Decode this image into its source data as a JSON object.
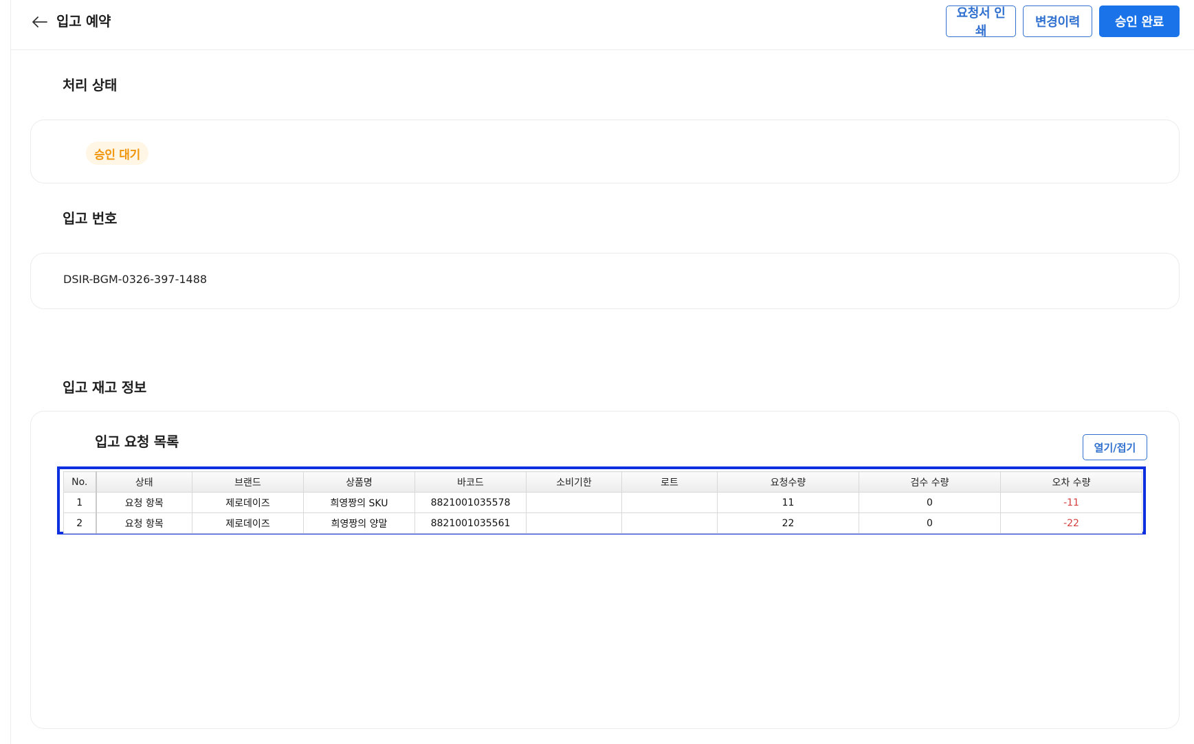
{
  "header": {
    "title": "입고 예약",
    "buttons": {
      "print": "요청서 인쇄",
      "history": "변경이력",
      "approve": "승인 완료"
    }
  },
  "status_section": {
    "label": "처리 상태",
    "badge": "승인 대기"
  },
  "number_section": {
    "label": "입고 번호",
    "value": "DSIR-BGM-0326-397-1488"
  },
  "inventory_section": {
    "label": "입고 재고 정보",
    "list_title": "입고 요청 목록",
    "toggle_label": "열기/접기",
    "columns": [
      "No.",
      "상태",
      "브랜드",
      "상품명",
      "바코드",
      "소비기한",
      "로트",
      "요청수량",
      "검수 수량",
      "오차 수량"
    ],
    "rows": [
      [
        "1",
        "요청 항목",
        "제로데이즈",
        "희영짱의 SKU",
        "8821001035578",
        "",
        "",
        "11",
        "0",
        "-11"
      ],
      [
        "2",
        "요청 항목",
        "제로데이즈",
        "희영짱의 양말",
        "8821001035561",
        "",
        "",
        "22",
        "0",
        "-22"
      ]
    ]
  },
  "colors": {
    "accent": "#1a73e8",
    "pending": "#f0940a",
    "negative": "#d63d3d",
    "highlight_border": "#0c2fe0"
  }
}
